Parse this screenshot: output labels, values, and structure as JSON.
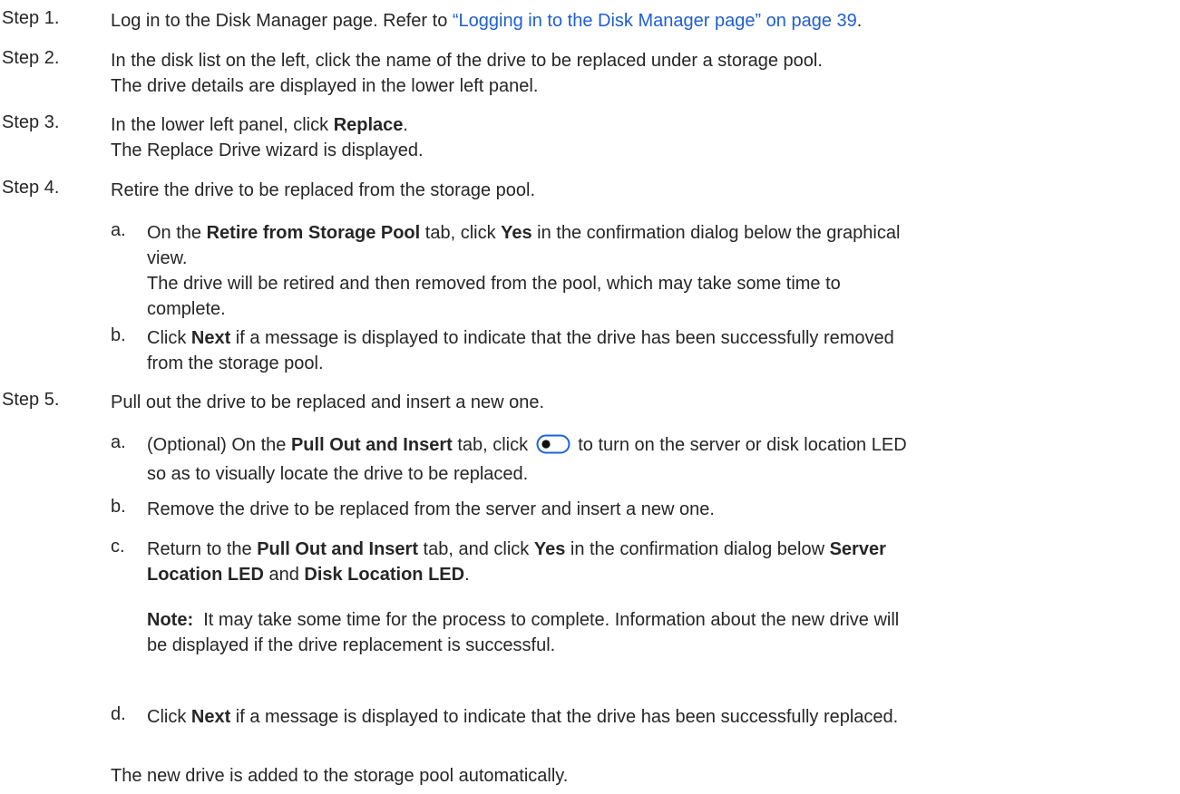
{
  "steps": [
    {
      "label": "Step 1.",
      "pre": "Log in to the Disk Manager page. Refer to ",
      "link": "“Logging in to the Disk Manager page” on page 39",
      "post": "."
    },
    {
      "label": "Step 2.",
      "line1": "In the disk list on the left, click the name of the drive to be replaced under a storage pool.",
      "line2": "The drive details are displayed in the lower left panel."
    },
    {
      "label": "Step 3.",
      "pre": "In the lower left panel, click ",
      "bold": "Replace",
      "post": ".",
      "line2": "The Replace Drive wizard is displayed."
    },
    {
      "label": "Step 4.",
      "text": "Retire the drive to be replaced from the storage pool.",
      "subs": [
        {
          "letter": "a.",
          "t1": "On the ",
          "b1": "Retire from Storage Pool",
          "t2": " tab, click ",
          "b2": "Yes",
          "t3": " in the confirmation dialog below the graphical",
          "t4": "view.",
          "r1": "The drive will be retired and then removed from the pool, which may take some time to",
          "r2": "complete."
        },
        {
          "letter": "b.",
          "t1": "Click ",
          "b1": "Next",
          "t2": " if a message is displayed to indicate that the drive has been successfully removed",
          "t3": "from the storage pool."
        }
      ]
    },
    {
      "label": "Step 5.",
      "text": "Pull out the drive to be replaced and insert a new one.",
      "subs": [
        {
          "letter": "a.",
          "t1": "(Optional) On the ",
          "b1": "Pull Out and Insert",
          "t2": " tab, click ",
          "t3": " to turn on the server or disk location LED",
          "t4": "so as to visually locate the drive to be replaced."
        },
        {
          "letter": "b.",
          "t1": "Remove the drive to be replaced from the server and insert a new one."
        },
        {
          "letter": "c.",
          "t1": "Return to the ",
          "b1": "Pull Out and Insert",
          "t2": " tab, and click ",
          "b2": "Yes",
          "t3": " in the confirmation dialog below ",
          "b3": "Server",
          "b4": "Location LED",
          "t4": " and ",
          "b5": "Disk Location LED",
          "t5": ".",
          "note_label": "Note:",
          "note1": "  It may take some time for the process to complete. Information about the new drive will",
          "note2": "be displayed if the drive replacement is successful."
        },
        {
          "letter": "d.",
          "t1": "Click ",
          "b1": "Next",
          "t2": " if a message is displayed to indicate that the drive has been successfully replaced."
        }
      ]
    }
  ],
  "closing": "The new drive is added to the storage pool automatically.",
  "icons": {
    "toggle": "toggle-switch-icon"
  },
  "colors": {
    "link": "#1f5fd1",
    "text": "#262626"
  }
}
